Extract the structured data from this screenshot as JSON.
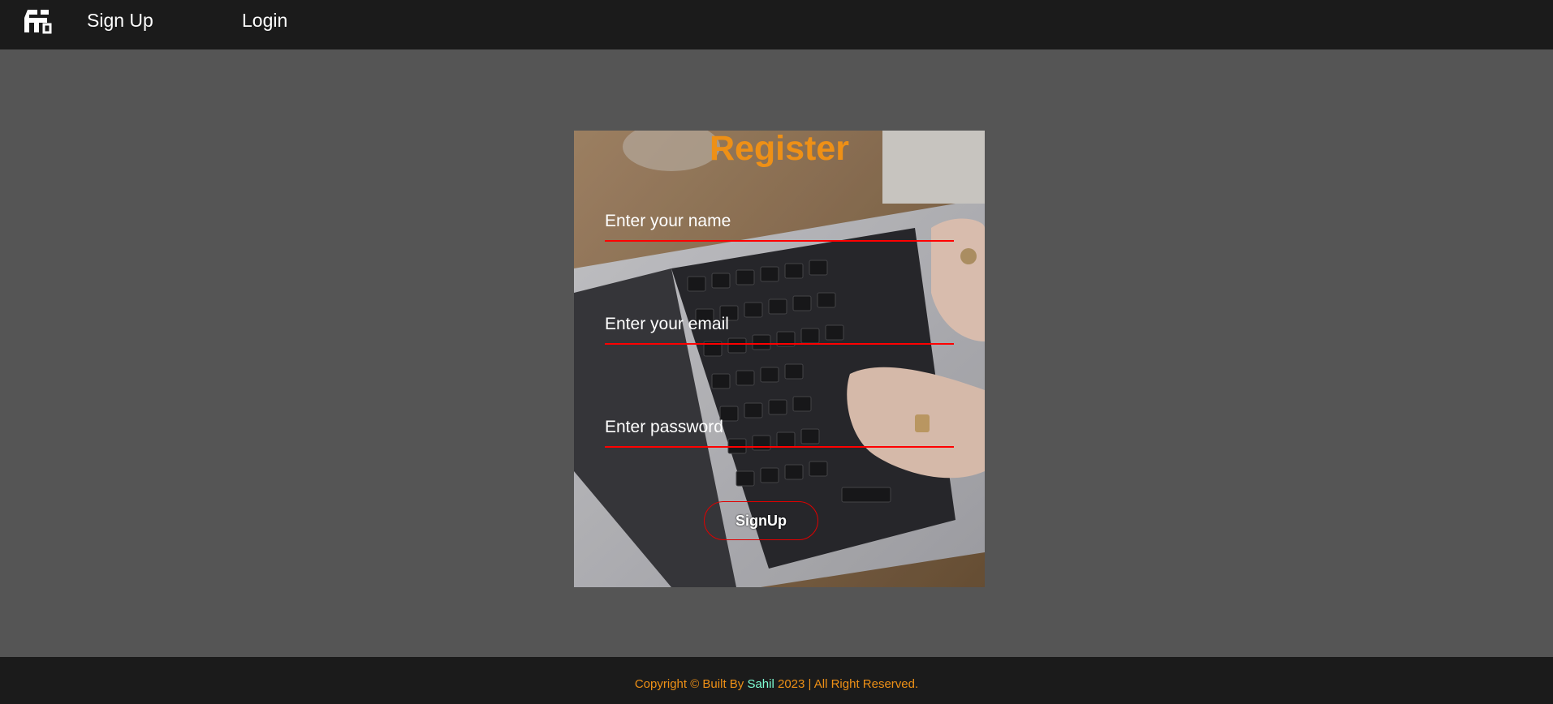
{
  "nav": {
    "logo_icon": "brand-logo-icon",
    "signup_label": "Sign Up",
    "login_label": "Login"
  },
  "form": {
    "title": "Register",
    "name_placeholder": "Enter your name",
    "email_placeholder": "Enter your email",
    "password_placeholder": "Enter password",
    "submit_label": "SignUp"
  },
  "footer": {
    "prefix": "Copyright © Built By ",
    "name": "Sahil",
    "suffix": " 2023 | All Right Reserved."
  },
  "colors": {
    "accent": "#ee9016",
    "underline": "#ff0000",
    "name_highlight": "#7fffd4",
    "bar": "#1b1b1b",
    "page_bg": "#555555"
  }
}
